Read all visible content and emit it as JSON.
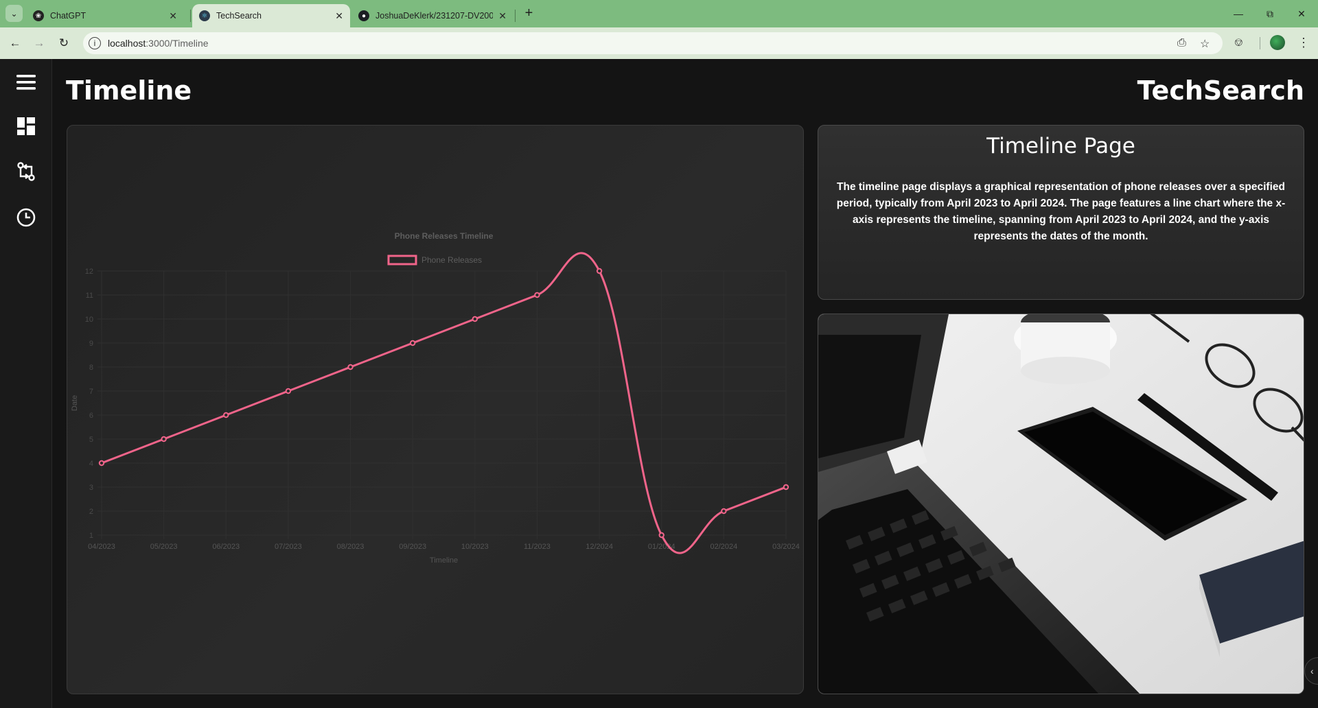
{
  "browser": {
    "tabs": [
      {
        "title": "ChatGPT",
        "icon": "chatgpt-icon"
      },
      {
        "title": "TechSearch",
        "icon": "react-icon",
        "active": true
      },
      {
        "title": "JoshuaDeKlerk/231207-DV200-",
        "icon": "github-icon"
      }
    ],
    "url_host": "localhost",
    "url_path": ":3000/Timeline",
    "accent": "#7dbb7f"
  },
  "nav": {
    "items": [
      {
        "icon": "menu-icon"
      },
      {
        "icon": "dashboard-icon"
      },
      {
        "icon": "compare-icon"
      },
      {
        "icon": "clock-icon"
      }
    ]
  },
  "header": {
    "title": "Timeline",
    "brand": "TechSearch"
  },
  "info": {
    "title": "Timeline Page",
    "body": "The timeline page displays a graphical representation of phone releases over a specified period, typically from April 2023 to April 2024. The page features a line chart where the x-axis represents the timeline, spanning from April 2023 to April 2024, and the y-axis represents the dates of the month."
  },
  "photo": {
    "description": "laptop-phone-desk-photo"
  },
  "chart_data": {
    "type": "line",
    "title": "Phone Releases Timeline",
    "xlabel": "Timeline",
    "ylabel": "Date",
    "categories": [
      "04/2023",
      "05/2023",
      "06/2023",
      "07/2023",
      "08/2023",
      "09/2023",
      "10/2023",
      "11/2023",
      "12/2024",
      "01/2024",
      "02/2024",
      "03/2024"
    ],
    "series": [
      {
        "name": "Phone Releases",
        "values": [
          4,
          5,
          6,
          7,
          8,
          9,
          10,
          11,
          12,
          1,
          2,
          3
        ],
        "color": "#f0648a"
      }
    ],
    "ylim": [
      1,
      12
    ],
    "yticks": [
      1,
      2,
      3,
      4,
      5,
      6,
      7,
      8,
      9,
      10,
      11,
      12
    ],
    "grid": true,
    "legend": "top"
  }
}
